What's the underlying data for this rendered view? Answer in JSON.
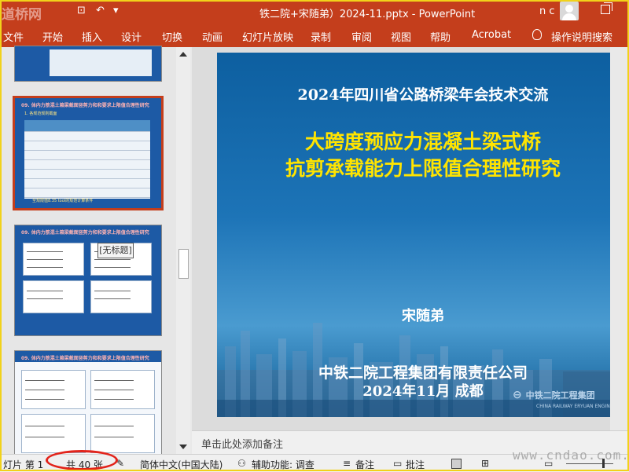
{
  "window": {
    "title": "铁二院+宋随弟）2024-11.pptx  -  PowerPoint",
    "user_initials": "n c",
    "watermark_top": "道桥网",
    "watermark_bottom": "www.cndao.com."
  },
  "ribbon": {
    "tabs": [
      "文件",
      "开始",
      "插入",
      "设计",
      "切换",
      "动画",
      "幻灯片放映",
      "录制",
      "审阅",
      "视图",
      "帮助",
      "Acrobat"
    ],
    "search": "操作说明搜索"
  },
  "thumbnails": {
    "slide_header": "09. 体内力筋混土箱梁截面竖剪力和和要求上限值合理性研究",
    "slide_sub": "1. 各规范规则截面",
    "slide_note": "全规限值8.35 tool的规范计算条件",
    "untitled_tag": "[无标题]"
  },
  "slide": {
    "conference": "2024年四川省公路桥梁年会技术交流",
    "title_line1": "大跨度预应力混凝土梁式桥",
    "title_line2": "抗剪承载能力上限值合理性研究",
    "author": "宋随弟",
    "organization": "中铁二院工程集团有限责任公司",
    "date_place": "2024年11月  成都",
    "logo_cn": "中铁二院工程集团",
    "logo_en": "CHINA RAILWAY ERYUAN ENGINEERING"
  },
  "notes": {
    "placeholder": "单击此处添加备注"
  },
  "status": {
    "slide_prefix": "灯片 第 1",
    "slide_count": "共 40 张",
    "language": "简体中文(中国大陆)",
    "accessibility": "辅助功能: 调查",
    "notes_btn": "备注",
    "comments_btn": "批注"
  }
}
